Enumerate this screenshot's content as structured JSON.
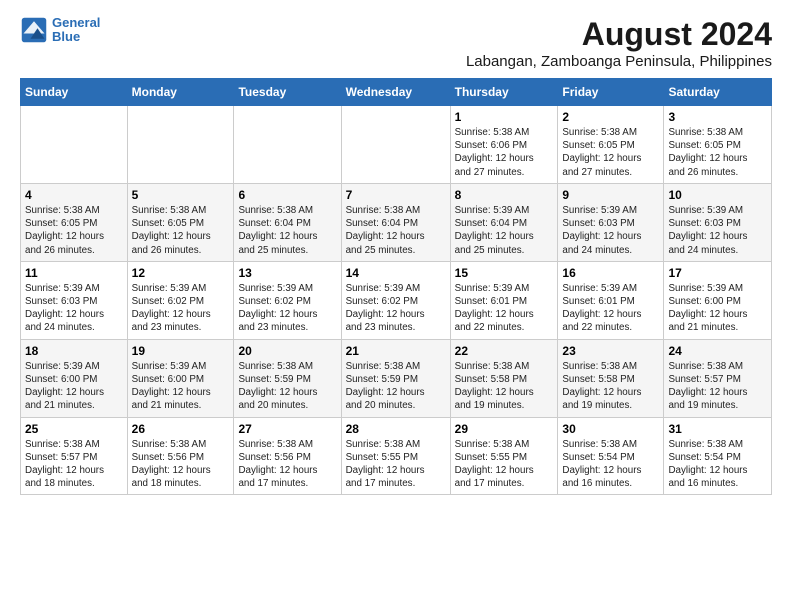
{
  "logo": {
    "line1": "General",
    "line2": "Blue"
  },
  "title": "August 2024",
  "location": "Labangan, Zamboanga Peninsula, Philippines",
  "days_of_week": [
    "Sunday",
    "Monday",
    "Tuesday",
    "Wednesday",
    "Thursday",
    "Friday",
    "Saturday"
  ],
  "weeks": [
    [
      {
        "day": "",
        "info": ""
      },
      {
        "day": "",
        "info": ""
      },
      {
        "day": "",
        "info": ""
      },
      {
        "day": "",
        "info": ""
      },
      {
        "day": "1",
        "info": "Sunrise: 5:38 AM\nSunset: 6:06 PM\nDaylight: 12 hours\nand 27 minutes."
      },
      {
        "day": "2",
        "info": "Sunrise: 5:38 AM\nSunset: 6:05 PM\nDaylight: 12 hours\nand 27 minutes."
      },
      {
        "day": "3",
        "info": "Sunrise: 5:38 AM\nSunset: 6:05 PM\nDaylight: 12 hours\nand 26 minutes."
      }
    ],
    [
      {
        "day": "4",
        "info": "Sunrise: 5:38 AM\nSunset: 6:05 PM\nDaylight: 12 hours\nand 26 minutes."
      },
      {
        "day": "5",
        "info": "Sunrise: 5:38 AM\nSunset: 6:05 PM\nDaylight: 12 hours\nand 26 minutes."
      },
      {
        "day": "6",
        "info": "Sunrise: 5:38 AM\nSunset: 6:04 PM\nDaylight: 12 hours\nand 25 minutes."
      },
      {
        "day": "7",
        "info": "Sunrise: 5:38 AM\nSunset: 6:04 PM\nDaylight: 12 hours\nand 25 minutes."
      },
      {
        "day": "8",
        "info": "Sunrise: 5:39 AM\nSunset: 6:04 PM\nDaylight: 12 hours\nand 25 minutes."
      },
      {
        "day": "9",
        "info": "Sunrise: 5:39 AM\nSunset: 6:03 PM\nDaylight: 12 hours\nand 24 minutes."
      },
      {
        "day": "10",
        "info": "Sunrise: 5:39 AM\nSunset: 6:03 PM\nDaylight: 12 hours\nand 24 minutes."
      }
    ],
    [
      {
        "day": "11",
        "info": "Sunrise: 5:39 AM\nSunset: 6:03 PM\nDaylight: 12 hours\nand 24 minutes."
      },
      {
        "day": "12",
        "info": "Sunrise: 5:39 AM\nSunset: 6:02 PM\nDaylight: 12 hours\nand 23 minutes."
      },
      {
        "day": "13",
        "info": "Sunrise: 5:39 AM\nSunset: 6:02 PM\nDaylight: 12 hours\nand 23 minutes."
      },
      {
        "day": "14",
        "info": "Sunrise: 5:39 AM\nSunset: 6:02 PM\nDaylight: 12 hours\nand 23 minutes."
      },
      {
        "day": "15",
        "info": "Sunrise: 5:39 AM\nSunset: 6:01 PM\nDaylight: 12 hours\nand 22 minutes."
      },
      {
        "day": "16",
        "info": "Sunrise: 5:39 AM\nSunset: 6:01 PM\nDaylight: 12 hours\nand 22 minutes."
      },
      {
        "day": "17",
        "info": "Sunrise: 5:39 AM\nSunset: 6:00 PM\nDaylight: 12 hours\nand 21 minutes."
      }
    ],
    [
      {
        "day": "18",
        "info": "Sunrise: 5:39 AM\nSunset: 6:00 PM\nDaylight: 12 hours\nand 21 minutes."
      },
      {
        "day": "19",
        "info": "Sunrise: 5:39 AM\nSunset: 6:00 PM\nDaylight: 12 hours\nand 21 minutes."
      },
      {
        "day": "20",
        "info": "Sunrise: 5:38 AM\nSunset: 5:59 PM\nDaylight: 12 hours\nand 20 minutes."
      },
      {
        "day": "21",
        "info": "Sunrise: 5:38 AM\nSunset: 5:59 PM\nDaylight: 12 hours\nand 20 minutes."
      },
      {
        "day": "22",
        "info": "Sunrise: 5:38 AM\nSunset: 5:58 PM\nDaylight: 12 hours\nand 19 minutes."
      },
      {
        "day": "23",
        "info": "Sunrise: 5:38 AM\nSunset: 5:58 PM\nDaylight: 12 hours\nand 19 minutes."
      },
      {
        "day": "24",
        "info": "Sunrise: 5:38 AM\nSunset: 5:57 PM\nDaylight: 12 hours\nand 19 minutes."
      }
    ],
    [
      {
        "day": "25",
        "info": "Sunrise: 5:38 AM\nSunset: 5:57 PM\nDaylight: 12 hours\nand 18 minutes."
      },
      {
        "day": "26",
        "info": "Sunrise: 5:38 AM\nSunset: 5:56 PM\nDaylight: 12 hours\nand 18 minutes."
      },
      {
        "day": "27",
        "info": "Sunrise: 5:38 AM\nSunset: 5:56 PM\nDaylight: 12 hours\nand 17 minutes."
      },
      {
        "day": "28",
        "info": "Sunrise: 5:38 AM\nSunset: 5:55 PM\nDaylight: 12 hours\nand 17 minutes."
      },
      {
        "day": "29",
        "info": "Sunrise: 5:38 AM\nSunset: 5:55 PM\nDaylight: 12 hours\nand 17 minutes."
      },
      {
        "day": "30",
        "info": "Sunrise: 5:38 AM\nSunset: 5:54 PM\nDaylight: 12 hours\nand 16 minutes."
      },
      {
        "day": "31",
        "info": "Sunrise: 5:38 AM\nSunset: 5:54 PM\nDaylight: 12 hours\nand 16 minutes."
      }
    ]
  ]
}
